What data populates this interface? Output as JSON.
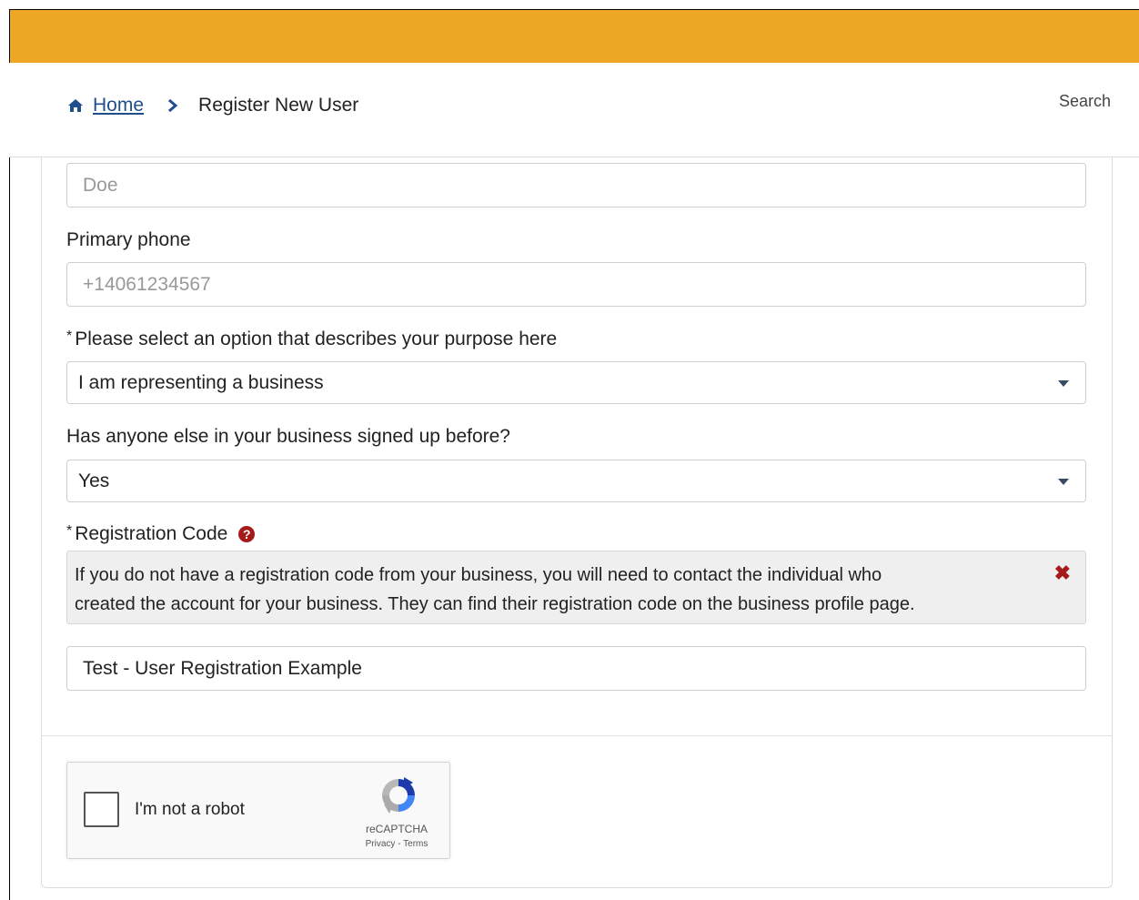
{
  "header": {
    "breadcrumb": {
      "home_label": "Home",
      "current_label": "Register New User"
    },
    "search_label": "Search",
    "accent_color": "#eda724"
  },
  "form": {
    "last_name": {
      "placeholder": "Doe"
    },
    "phone": {
      "label": "Primary phone",
      "placeholder": "+14061234567"
    },
    "purpose": {
      "required_mark": "*",
      "label": "Please select an option that describes your purpose here",
      "selected": "I am representing a business"
    },
    "signed_up_before": {
      "label": "Has anyone else in your business signed up before?",
      "selected": "Yes"
    },
    "registration_code": {
      "required_mark": "*",
      "label": "Registration Code",
      "help_icon": "question-circle-icon",
      "info_line1": "If you do not have a registration code from your business, you will need to contact the individual who",
      "info_line2": "created the account for your business. They can find their registration code on the business profile page.",
      "value": "Test - User Registration Example"
    }
  },
  "recaptcha": {
    "label": "I'm not a robot",
    "brand": "reCAPTCHA",
    "terms": "Privacy - Terms"
  }
}
